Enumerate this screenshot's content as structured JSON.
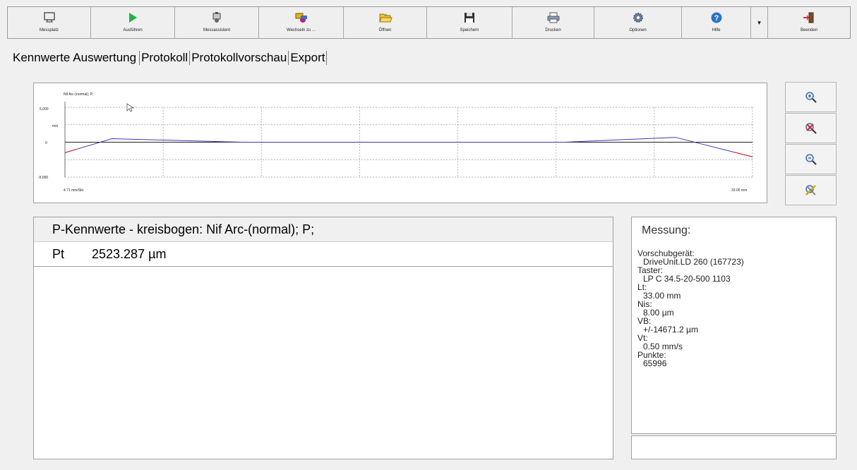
{
  "toolbar": {
    "buttons": [
      {
        "label": "Messplatz",
        "icon": "monitor-icon"
      },
      {
        "label": "Ausführen",
        "icon": "play-icon"
      },
      {
        "label": "Messassistent",
        "icon": "wizard-icon"
      },
      {
        "label": "Wechseln zu ...",
        "icon": "switch-icon"
      },
      {
        "label": "Öffnen",
        "icon": "folder-open-icon"
      },
      {
        "label": "Speichern",
        "icon": "save-icon"
      },
      {
        "label": "Drucken",
        "icon": "printer-icon"
      },
      {
        "label": "Optionen",
        "icon": "gear-icon"
      },
      {
        "label": "Hilfe",
        "icon": "help-icon"
      },
      {
        "label": "Beenden",
        "icon": "exit-door-icon"
      }
    ],
    "dropdown": "▾"
  },
  "tabs": [
    "Kennwerte",
    "Auswertung",
    "Protokoll",
    "Protokollvorschau",
    "Export"
  ],
  "chart": {
    "title": "Nif Arc-(normal); P;",
    "unit": "mm",
    "y_ticks": [
      "5,000",
      "0",
      "-5,000"
    ],
    "x_left_label": "4.71 mm/Skt",
    "x_right_label": "33.00 mm"
  },
  "chart_data": {
    "type": "line",
    "title": "Nif Arc-(normal); P;",
    "ylabel": "mm",
    "ylim": [
      -5,
      5
    ],
    "xlim": [
      0,
      33
    ],
    "grid": true,
    "series": [
      {
        "color": "#3a3ab0",
        "x": [
          0,
          2.26,
          8.5,
          10.0,
          18.0,
          24.0,
          29.3,
          33.0
        ],
        "y": [
          -1.5,
          0.5,
          0.0,
          0.0,
          0.0,
          0.0,
          0.7,
          -2.1
        ]
      }
    ]
  },
  "zoom_buttons": [
    "zoom-in-icon",
    "zoom-reset-icon",
    "zoom-out-icon",
    "zoom-tools-icon"
  ],
  "results": {
    "header": "P-Kennwerte - kreisbogen: Nif Arc-(normal); P;",
    "rows": [
      {
        "key": "Pt",
        "value": "2523.287 µm"
      }
    ]
  },
  "messung": {
    "title": "Messung:",
    "items": [
      {
        "label": "Vorschubgerät:",
        "value": "DriveUnit.LD 260 (167723)"
      },
      {
        "label": "Taster:",
        "value": "LP C 34.5-20-500 1103"
      },
      {
        "label": "Lt:",
        "value": "33.00 mm"
      },
      {
        "label": "Nis:",
        "value": "8.00 µm"
      },
      {
        "label": "VB:",
        "value": "+/-14671.2 µm"
      },
      {
        "label": "Vt:",
        "value": "0.50 mm/s"
      },
      {
        "label": "Punkte:",
        "value": "65996"
      }
    ]
  }
}
